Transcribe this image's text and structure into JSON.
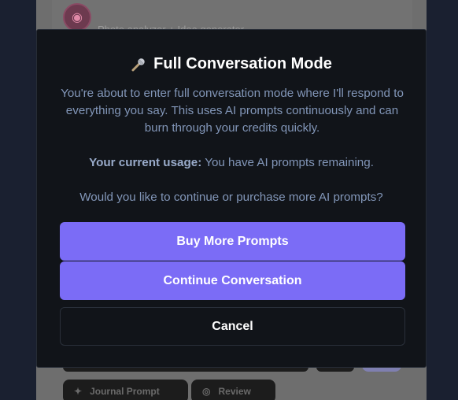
{
  "background": {
    "subtitle": "Photo analyzer + Idea generator",
    "chips": [
      "Journal Prompt",
      "Review"
    ]
  },
  "modal": {
    "title": "Full Conversation Mode",
    "icon": "microphone-icon",
    "description": "You're about to enter full conversation mode where I'll respond to everything you say. This uses AI prompts continuously and can burn through your credits quickly.",
    "usage_label": "Your current usage:",
    "usage_text": "You have AI prompts remaining.",
    "question": "Would you like to continue or purchase more AI prompts?",
    "buy_label": "Buy More Prompts",
    "continue_label": "Continue Conversation",
    "cancel_label": "Cancel"
  },
  "colors": {
    "accent": "#7b6cf6",
    "modal_bg": "#111419",
    "body_text": "#8296b8"
  }
}
